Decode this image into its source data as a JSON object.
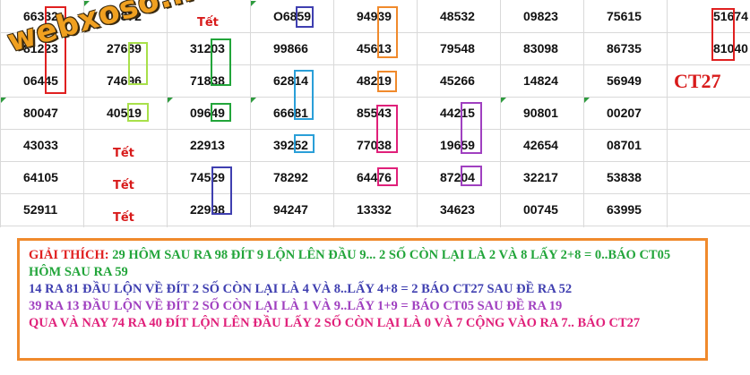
{
  "logo": {
    "text": "webxoso.net"
  },
  "label_ct27": "CT27",
  "rows": [
    [
      "66332",
      "00872",
      "Tết",
      "O6859",
      "94939",
      "48532",
      "09823",
      "75615",
      "51674"
    ],
    [
      "81223",
      "27689",
      "31203",
      "99866",
      "45613",
      "79548",
      "83098",
      "86735",
      "81040"
    ],
    [
      "06445",
      "74696",
      "71838",
      "62814",
      "48219",
      "45266",
      "14824",
      "56949",
      ""
    ],
    [
      "80047",
      "40519",
      "09649",
      "66681",
      "85543",
      "44215",
      "90801",
      "00207",
      ""
    ],
    [
      "43033",
      "Tết",
      "22913",
      "39252",
      "77038",
      "19659",
      "42654",
      "08701",
      ""
    ],
    [
      "64105",
      "Tết",
      "74529",
      "78292",
      "64476",
      "87204",
      "32217",
      "53838",
      ""
    ],
    [
      "52911",
      "Tết",
      "22998",
      "94247",
      "13332",
      "34623",
      "00745",
      "63995",
      ""
    ]
  ],
  "highlight_colors": {
    "red": "#e02020",
    "green_light": "#a8e04a",
    "green": "#22a53a",
    "blue": "#3f3fb0",
    "cyan": "#2a9fd8",
    "orange": "#f08a2c",
    "magenta": "#e0207a",
    "purple": "#a040c0"
  },
  "explanation": {
    "title": "GIẢI THÍCH:",
    "line1": "29 HÔM SAU RA 98 ĐÍT 9 LỘN LÊN ĐẦU 9... 2 SỐ CÒN LẠI LÀ 2 VÀ 8 LẤY 2+8 = 0..BÁO CT05 HÔM SAU RA 59",
    "line2": "14 RA 81 ĐẦU LỘN VỀ ĐÍT 2 SỐ CÒN LẠI LÀ 4 VÀ 8..LẤY 4+8 = 2 BÁO CT27 SAU ĐỀ RA 52",
    "line3": "39 RA 13 ĐẦU LỘN VỀ ĐÍT 2 SỐ CÒN LẠI LÀ 1 VÀ 9..LẤY 1+9 =  BÁO CT05 SAU ĐỀ RA 19",
    "line4": "QUA VÀ NAY 74 RA 40 ĐÍT LỘN LÊN ĐẦU LẤY 2 SỐ CÒN LẠI LÀ 0 VÀ 7 CỘNG VÀO RA 7.. BÁO CT27",
    "colors": {
      "title": "#e02020",
      "line1": "#22a53a",
      "line2": "#3f3fb0",
      "line3": "#a040c0",
      "line4": "#e0207a"
    }
  }
}
